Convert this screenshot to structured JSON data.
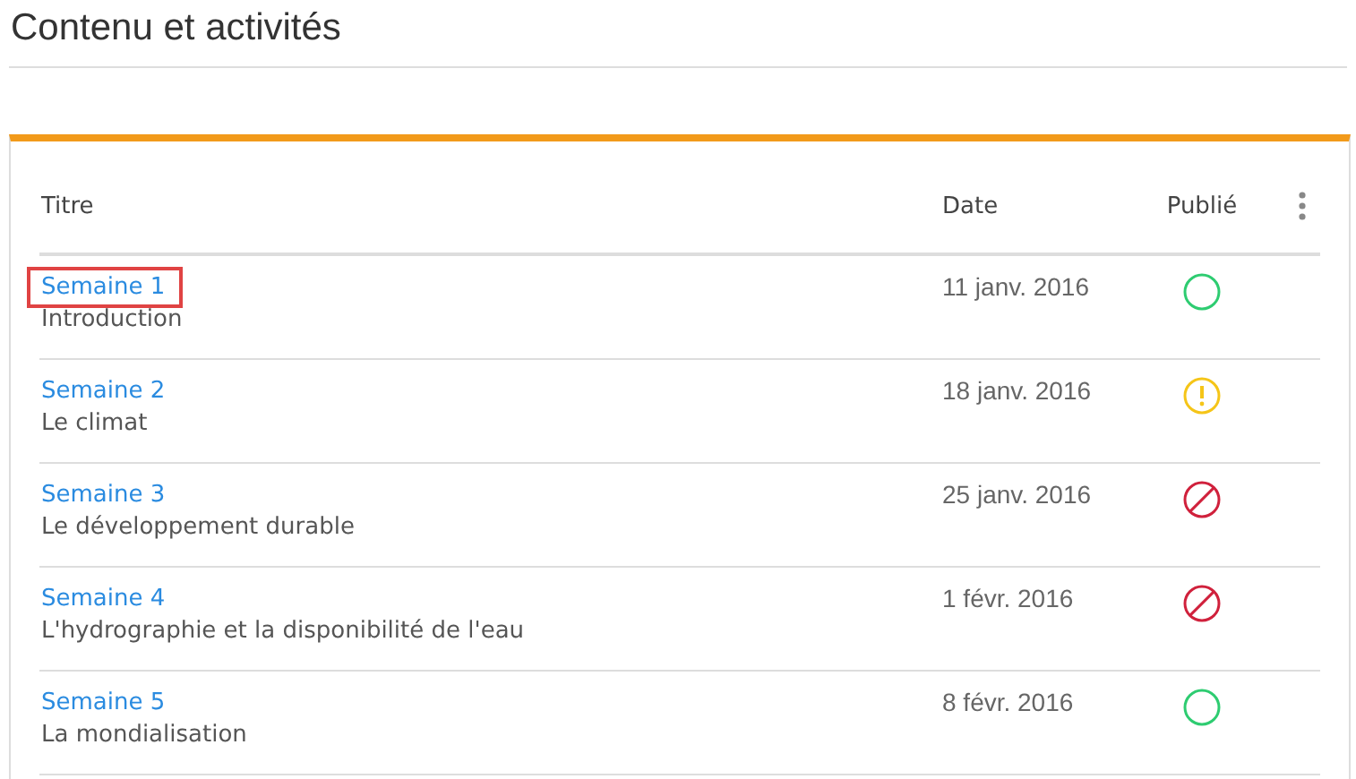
{
  "page_title": "Contenu et activités",
  "table": {
    "columns": [
      "Titre",
      "Date",
      "Publié"
    ],
    "rows": [
      {
        "title": "Semaine 1",
        "subtitle": "Introduction",
        "date": "11 janv. 2016",
        "kind": "published",
        "highlighted": true
      },
      {
        "title": "Semaine 2",
        "subtitle": "Le climat",
        "date": "18 janv. 2016",
        "kind": "warning",
        "highlighted": false
      },
      {
        "title": "Semaine 3",
        "subtitle": "Le développement durable",
        "date": "25 janv. 2016",
        "kind": "blocked",
        "highlighted": false
      },
      {
        "title": "Semaine 4",
        "subtitle": "L'hydrographie et la disponibilité de l'eau",
        "date": "1 févr. 2016",
        "kind": "blocked",
        "highlighted": false
      },
      {
        "title": "Semaine 5",
        "subtitle": "La mondialisation",
        "date": "8 févr. 2016",
        "kind": "published",
        "highlighted": false
      }
    ]
  }
}
